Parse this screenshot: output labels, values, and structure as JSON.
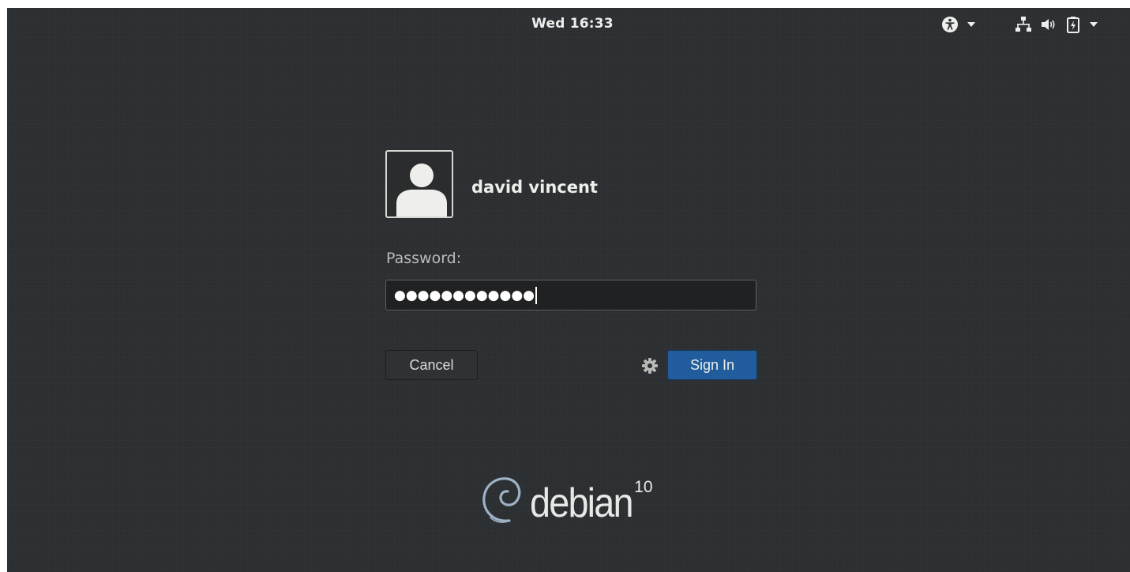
{
  "topbar": {
    "clock": "Wed 16:33",
    "icons": [
      "accessibility-icon",
      "chevron-down-icon",
      "network-icon",
      "volume-icon",
      "battery-icon",
      "chevron-down-icon"
    ]
  },
  "login": {
    "username": "david vincent",
    "password_label": "Password:",
    "password_masked": "●●●●●●●●●●●●",
    "cancel_label": "Cancel",
    "signin_label": "Sign In"
  },
  "branding": {
    "word": "debian",
    "version": "10"
  },
  "colors": {
    "background": "#2c2f31",
    "accent": "#215d9c",
    "text": "#eeeeec"
  }
}
